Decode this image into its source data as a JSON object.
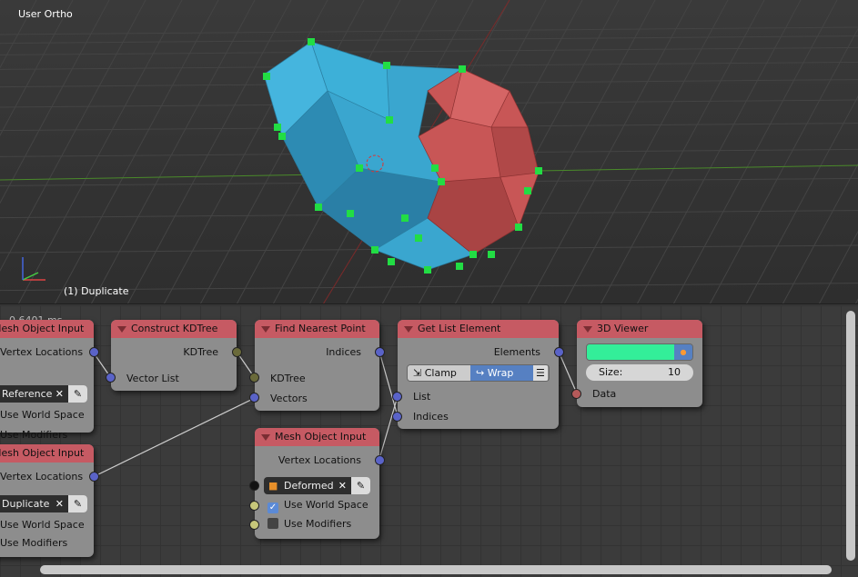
{
  "viewport": {
    "view_label": "User Ortho",
    "object_label": "(1) Duplicate",
    "axis_labels": {
      "x": "x",
      "y": "y",
      "z": "z"
    }
  },
  "editor": {
    "timing": "0.6401 ms"
  },
  "nodes": {
    "mesh_input_1": {
      "title": "Mesh Object Input",
      "output": "Vertex Locations",
      "object": "Reference",
      "use_world_space": "Use World Space",
      "use_modifiers": "Use Modifiers"
    },
    "kdtree": {
      "title": "Construct KDTree",
      "output": "KDTree",
      "input": "Vector List"
    },
    "nearest": {
      "title": "Find Nearest Point",
      "output": "Indices",
      "input_kdtree": "KDTree",
      "input_vectors": "Vectors"
    },
    "get_list": {
      "title": "Get List Element",
      "output": "Elements",
      "clamp": "Clamp",
      "wrap": "Wrap",
      "selected_mode": "Wrap",
      "input_list": "List",
      "input_indices": "Indices"
    },
    "viewer": {
      "title": "3D Viewer",
      "color": "#33ee99",
      "size_label": "Size:",
      "size_value": "10",
      "input": "Data"
    },
    "mesh_input_2": {
      "title": "Mesh Object Input",
      "output": "Vertex Locations",
      "object": "Duplicate",
      "use_world_space": "Use World Space",
      "use_modifiers": "Use Modifiers"
    },
    "mesh_input_3": {
      "title": "Mesh Object Input",
      "output": "Vertex Locations",
      "object": "Deformed",
      "use_world_space": "Use World Space",
      "use_world_space_checked": true,
      "use_modifiers": "Use Modifiers",
      "use_modifiers_checked": false
    }
  },
  "colors": {
    "header": "#c65a63",
    "vector_socket": "#5a63c8",
    "mesh_blue": "#3aa6cf",
    "mesh_red": "#c85656",
    "vertex": "#22dd44"
  }
}
